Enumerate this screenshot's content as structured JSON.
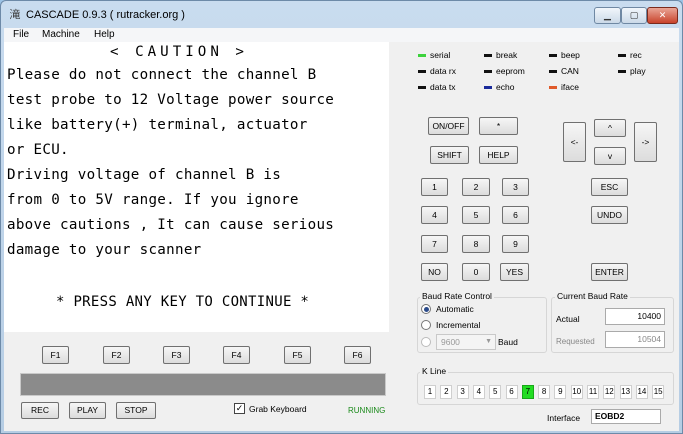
{
  "window": {
    "title": "CASCADE 0.9.3 ( rutracker.org )",
    "icon": "app-glyph-icon",
    "minimize": "▁",
    "maximize": "▢",
    "close": "✕"
  },
  "menu": [
    "File",
    "Machine",
    "Help"
  ],
  "lcd": {
    "caution": "< CAUTION >",
    "lines": [
      "Please do not connect the channel B",
      "test probe to 12 Voltage power source",
      "like battery(+) terminal, actuator",
      "or ECU.",
      "Driving voltage of channel B is",
      "from 0 to 5V range. If you ignore",
      "above cautions , It can cause serious",
      "damage to your scanner"
    ],
    "press": "* PRESS ANY KEY TO CONTINUE *"
  },
  "fkeys": [
    "F1",
    "F2",
    "F3",
    "F4",
    "F5",
    "F6"
  ],
  "transport": {
    "rec": "REC",
    "play": "PLAY",
    "stop": "STOP"
  },
  "grab_keyboard": {
    "label": "Grab Keyboard",
    "checked": true
  },
  "status": {
    "running": "RUNNING",
    "running_color": "#1a8a1a"
  },
  "indicators": [
    {
      "label": "serial",
      "color": "#3cd23c"
    },
    {
      "label": "break",
      "color": "#111111"
    },
    {
      "label": "beep",
      "color": "#111111"
    },
    {
      "label": "rec",
      "color": "#111111"
    },
    {
      "label": "data rx",
      "color": "#111111"
    },
    {
      "label": "eeprom",
      "color": "#111111"
    },
    {
      "label": "CAN",
      "color": "#111111"
    },
    {
      "label": "play",
      "color": "#111111"
    },
    {
      "label": "data tx",
      "color": "#111111"
    },
    {
      "label": "echo",
      "color": "#1a2a9a"
    },
    {
      "label": "iface",
      "color": "#e05a2a"
    }
  ],
  "keypad": {
    "onoff": "ON/OFF",
    "star": "*",
    "shift": "SHIFT",
    "help": "HELP",
    "digits": [
      "1",
      "2",
      "3",
      "4",
      "5",
      "6",
      "7",
      "8",
      "9"
    ],
    "no": "NO",
    "zero": "0",
    "yes": "YES",
    "esc": "ESC",
    "undo": "UNDO",
    "enter": "ENTER",
    "left": "<-",
    "up": "^",
    "down": "v",
    "right": "->"
  },
  "baud_control": {
    "title": "Baud Rate Control",
    "automatic": "Automatic",
    "incremental": "Incremental",
    "custom_value": "9600",
    "baud": "Baud",
    "selected": "automatic"
  },
  "current_baud": {
    "title": "Current Baud Rate",
    "actual_label": "Actual",
    "actual": "10400",
    "requested_label": "Requested",
    "requested": "10504"
  },
  "kline": {
    "title": "K Line",
    "items": [
      "1",
      "2",
      "3",
      "4",
      "5",
      "6",
      "7",
      "8",
      "9",
      "10",
      "11",
      "12",
      "13",
      "14",
      "15"
    ],
    "active": "7",
    "active_color": "#22dd22"
  },
  "interface": {
    "label": "Interface",
    "value": "EOBD2"
  }
}
